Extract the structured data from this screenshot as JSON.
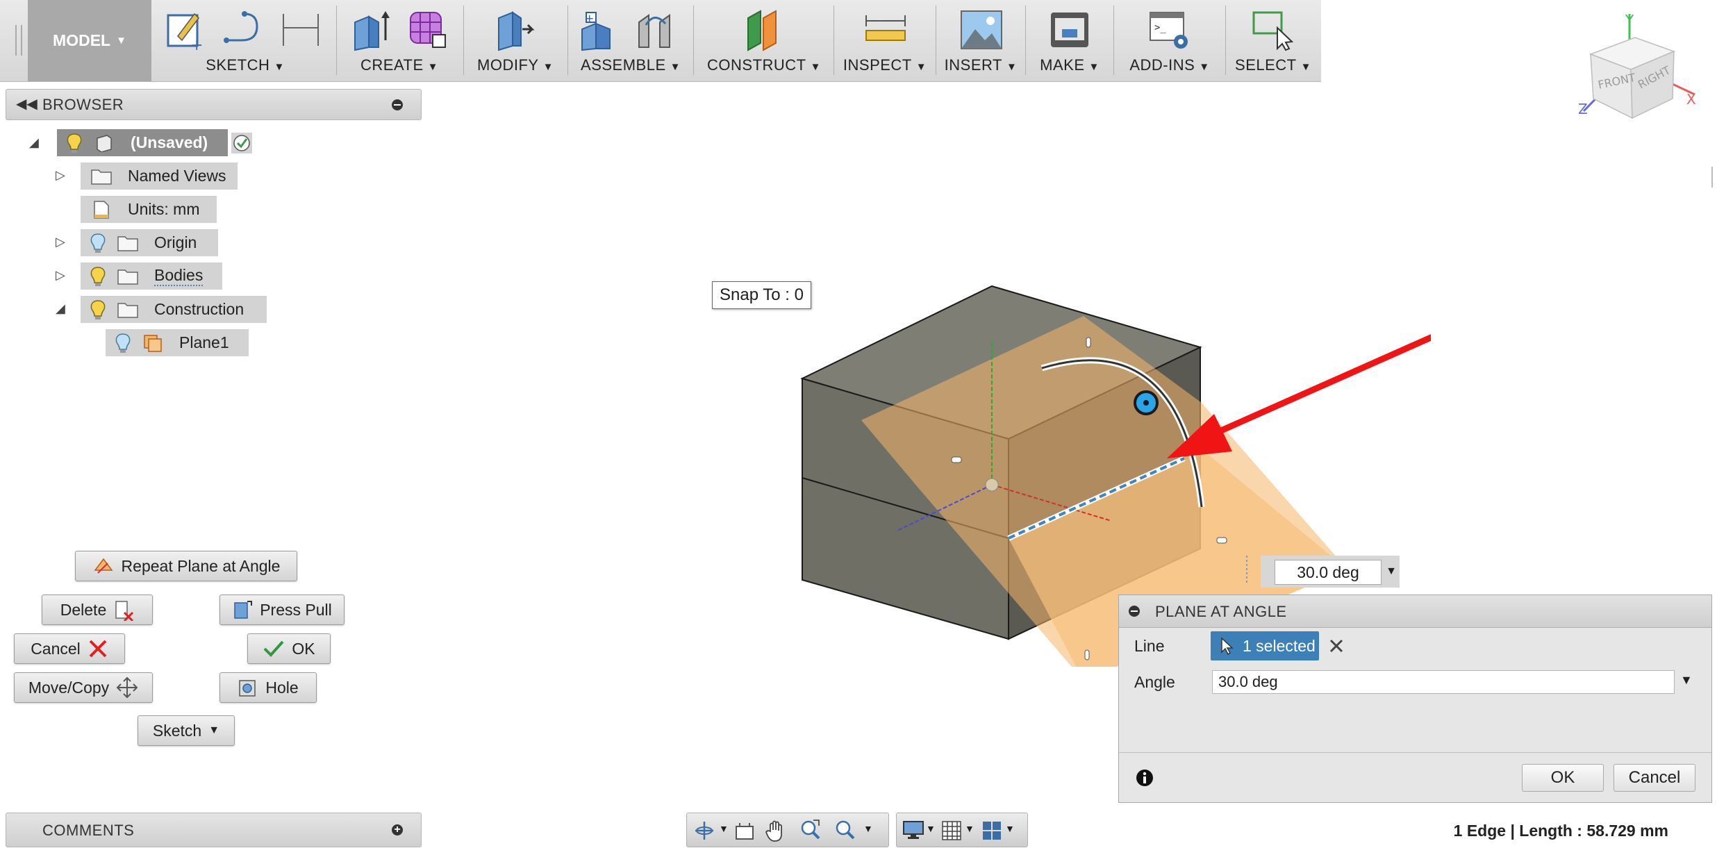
{
  "toolbar": {
    "workspace": "MODEL",
    "groups": [
      {
        "label": "SKETCH"
      },
      {
        "label": "CREATE"
      },
      {
        "label": "MODIFY"
      },
      {
        "label": "ASSEMBLE"
      },
      {
        "label": "CONSTRUCT"
      },
      {
        "label": "INSPECT"
      },
      {
        "label": "INSERT"
      },
      {
        "label": "MAKE"
      },
      {
        "label": "ADD-INS"
      },
      {
        "label": "SELECT"
      }
    ]
  },
  "viewcube": {
    "front": "FRONT",
    "right": "RIGHT",
    "axis_x": "X",
    "axis_y": "Y",
    "axis_z": "Z"
  },
  "browser": {
    "title": "BROWSER",
    "root": "(Unsaved)",
    "items": [
      {
        "label": "Named Views"
      },
      {
        "label": "Units: mm"
      },
      {
        "label": "Origin"
      },
      {
        "label": "Bodies"
      },
      {
        "label": "Construction"
      },
      {
        "label": "Plane1"
      }
    ]
  },
  "marking_menu": {
    "repeat": "Repeat Plane at Angle",
    "delete": "Delete",
    "press_pull": "Press Pull",
    "cancel": "Cancel",
    "ok": "OK",
    "move_copy": "Move/Copy",
    "hole": "Hole",
    "sketch": "Sketch"
  },
  "comments": {
    "title": "COMMENTS"
  },
  "canvas": {
    "snap_tooltip": "Snap To : 0",
    "angle_value": "30.0 deg"
  },
  "dialog": {
    "title": "PLANE AT ANGLE",
    "line_label": "Line",
    "line_value": "1 selected",
    "angle_label": "Angle",
    "angle_value": "30.0 deg",
    "ok": "OK",
    "cancel": "Cancel"
  },
  "status": "1 Edge | Length : 58.729 mm",
  "colors": {
    "selection_blue": "#3d80b8",
    "plane_orange": "#f5b56a",
    "arrow_red": "#f01414"
  }
}
